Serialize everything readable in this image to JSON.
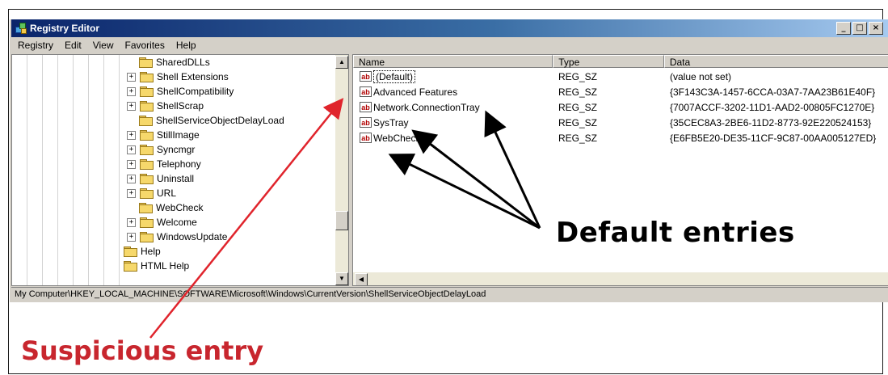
{
  "window": {
    "title": "Registry Editor",
    "controls": {
      "minimize": "_",
      "restore": "□",
      "close": "×"
    }
  },
  "menu": [
    "Registry",
    "Edit",
    "View",
    "Favorites",
    "Help"
  ],
  "tree": [
    {
      "label": "SharedDLLs",
      "expandable": false
    },
    {
      "label": "Shell Extensions",
      "expandable": true
    },
    {
      "label": "ShellCompatibility",
      "expandable": true
    },
    {
      "label": "ShellScrap",
      "expandable": true
    },
    {
      "label": "ShellServiceObjectDelayLoad",
      "expandable": false
    },
    {
      "label": "StillImage",
      "expandable": true
    },
    {
      "label": "Syncmgr",
      "expandable": true
    },
    {
      "label": "Telephony",
      "expandable": true
    },
    {
      "label": "Uninstall",
      "expandable": true
    },
    {
      "label": "URL",
      "expandable": true
    },
    {
      "label": "WebCheck",
      "expandable": false
    },
    {
      "label": "Welcome",
      "expandable": true
    },
    {
      "label": "WindowsUpdate",
      "expandable": true
    },
    {
      "label": "Help",
      "expandable": false
    },
    {
      "label": "HTML Help",
      "expandable": false
    }
  ],
  "list": {
    "columns": [
      "Name",
      "Type",
      "Data"
    ],
    "rows": [
      {
        "name": "(Default)",
        "type": "REG_SZ",
        "data": "(value not set)"
      },
      {
        "name": "Advanced Features",
        "type": "REG_SZ",
        "data": "{3F143C3A-1457-6CCA-03A7-7AA23B61E40F}"
      },
      {
        "name": "Network.ConnectionTray",
        "type": "REG_SZ",
        "data": "{7007ACCF-3202-11D1-AAD2-00805FC1270E}"
      },
      {
        "name": "SysTray",
        "type": "REG_SZ",
        "data": "{35CEC8A3-2BE6-11D2-8773-92E220524153}"
      },
      {
        "name": "WebCheck",
        "type": "REG_SZ",
        "data": "{E6FB5E20-DE35-11CF-9C87-00AA005127ED}"
      }
    ],
    "value_icon": "ab"
  },
  "status_path": "My Computer\\HKEY_LOCAL_MACHINE\\SOFTWARE\\Microsoft\\Windows\\CurrentVersion\\ShellServiceObjectDelayLoad",
  "annotations": {
    "default_entries": "Default entries",
    "suspicious_entry": "Suspicious entry"
  },
  "colors": {
    "title_bar": "#0a246a",
    "suspicious_arrow": "#e0242c",
    "default_arrow": "#000000"
  }
}
